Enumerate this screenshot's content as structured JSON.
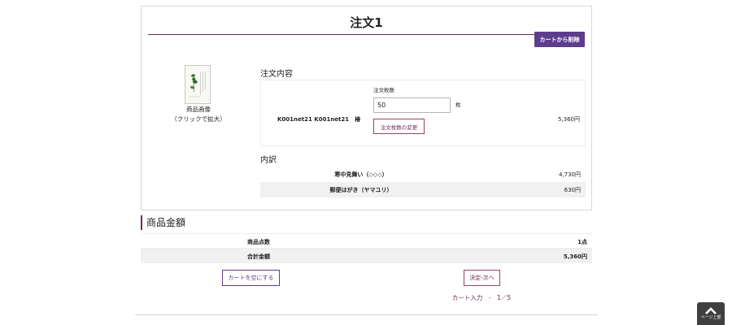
{
  "order": {
    "title": "注文1",
    "remove_button": "カートから削除",
    "image_caption_line1": "商品画像",
    "image_caption_line2": "（クリックで拡大）",
    "contents_heading": "注文内容",
    "quantity_label": "注文枚数",
    "product_name": "K001net21  K001net21　椿",
    "quantity_value": "50",
    "quantity_unit": "枚",
    "change_quantity_button": "注文枚数の変更",
    "line_price": "5,360円",
    "breakdown_heading": "内訳",
    "breakdown": [
      {
        "name": "寒中見舞い（◇◇◇）",
        "price": "4,730円"
      },
      {
        "name": "郵便はがき（ヤマユリ）",
        "price": "630円"
      }
    ]
  },
  "summary": {
    "heading": "商品金額",
    "rows": [
      {
        "name": "商品点数",
        "value": "1点"
      },
      {
        "name": "合計金額",
        "value": "5,360円"
      }
    ]
  },
  "actions": {
    "empty_cart": "カートを空にする",
    "next": "決定-次へ"
  },
  "step_indicator": "カート入力　-　1／5",
  "page_top_label": "ページ上部",
  "colors": {
    "accent_purple": "#5e3d8c",
    "accent_wine": "#6d2b58"
  }
}
